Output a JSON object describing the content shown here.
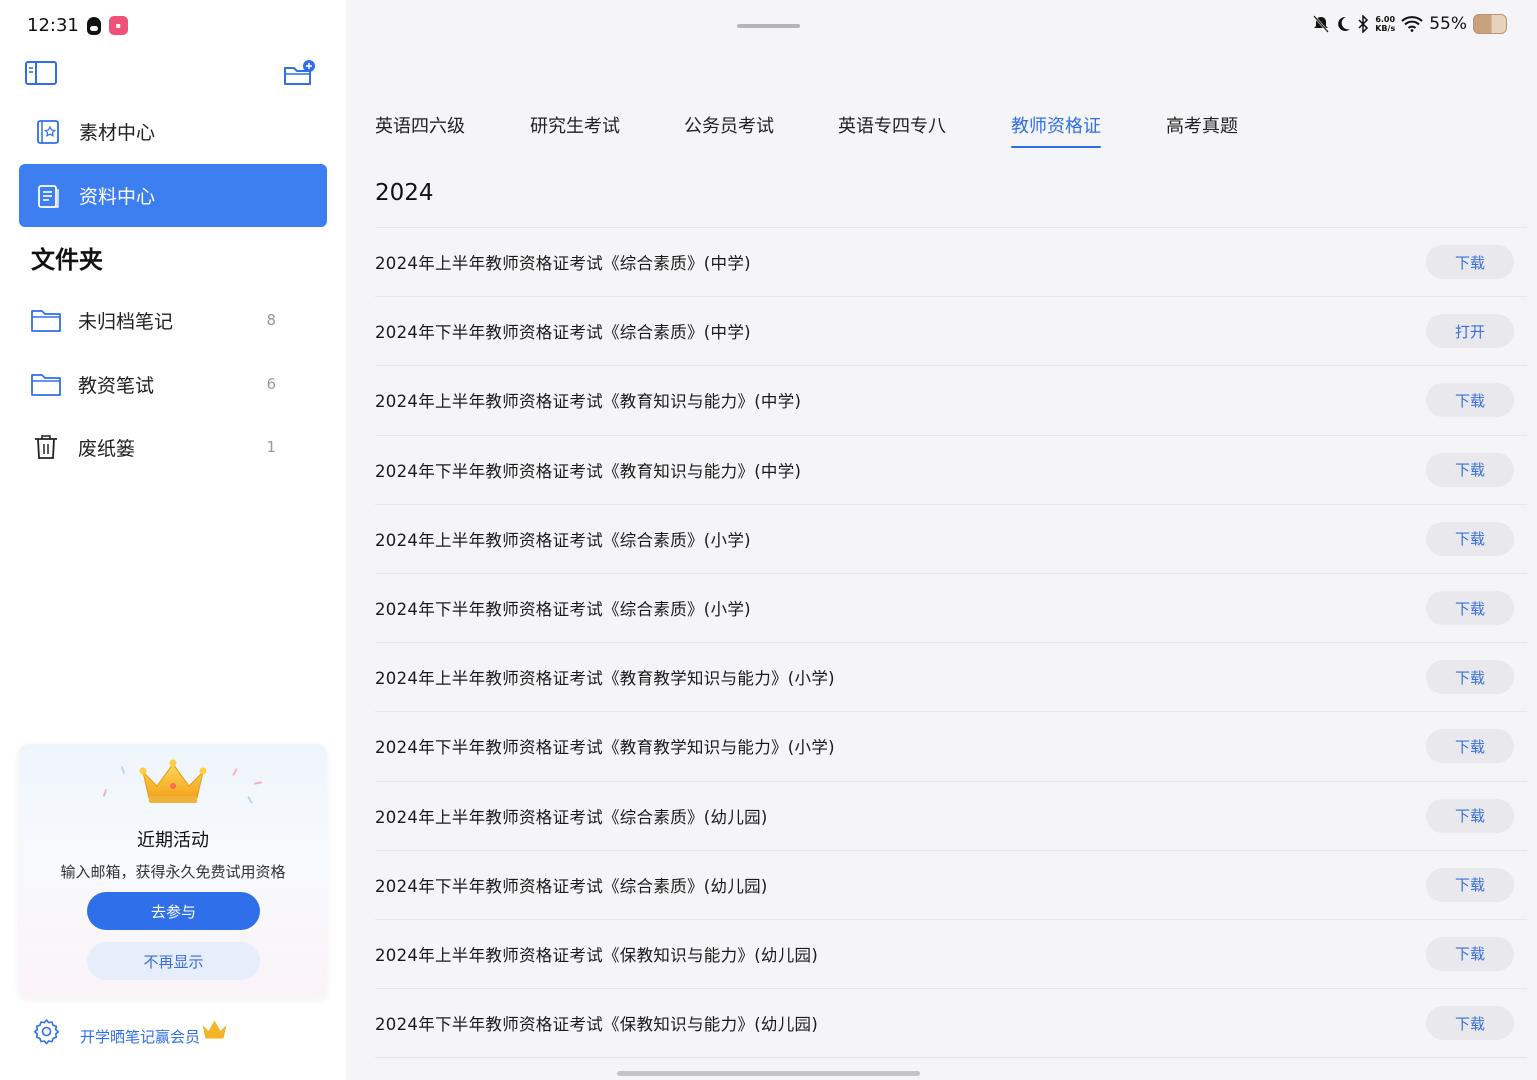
{
  "status": {
    "time": "12:31",
    "net_speed_value": "6.00",
    "net_speed_unit": "KB/s",
    "battery": "55%"
  },
  "sidebar": {
    "nav": [
      {
        "label": "素材中心",
        "active": false
      },
      {
        "label": "资料中心",
        "active": true
      }
    ],
    "folders_title": "文件夹",
    "folders": [
      {
        "label": "未归档笔记",
        "count": "8"
      },
      {
        "label": "教资笔试",
        "count": "6"
      },
      {
        "label": "废纸篓",
        "count": "1"
      }
    ],
    "promo": {
      "title": "近期活动",
      "desc": "输入邮箱，获得永久免费试用资格",
      "join": "去参与",
      "dismiss": "不再显示"
    },
    "footer_label": "开学晒笔记赢会员"
  },
  "tabs": [
    {
      "label": "英语四六级",
      "active": false
    },
    {
      "label": "研究生考试",
      "active": false
    },
    {
      "label": "公务员考试",
      "active": false
    },
    {
      "label": "英语专四专八",
      "active": false
    },
    {
      "label": "教师资格证",
      "active": true
    },
    {
      "label": "高考真题",
      "active": false
    }
  ],
  "year": "2024",
  "items": [
    {
      "title": "2024年上半年教师资格证考试《综合素质》(中学)",
      "action": "下载"
    },
    {
      "title": "2024年下半年教师资格证考试《综合素质》(中学)",
      "action": "打开"
    },
    {
      "title": "2024年上半年教师资格证考试《教育知识与能力》(中学)",
      "action": "下载"
    },
    {
      "title": "2024年下半年教师资格证考试《教育知识与能力》(中学)",
      "action": "下载"
    },
    {
      "title": "2024年上半年教师资格证考试《综合素质》(小学)",
      "action": "下载"
    },
    {
      "title": "2024年下半年教师资格证考试《综合素质》(小学)",
      "action": "下载"
    },
    {
      "title": "2024年上半年教师资格证考试《教育教学知识与能力》(小学)",
      "action": "下载"
    },
    {
      "title": "2024年下半年教师资格证考试《教育教学知识与能力》(小学)",
      "action": "下载"
    },
    {
      "title": "2024年上半年教师资格证考试《综合素质》(幼儿园)",
      "action": "下载"
    },
    {
      "title": "2024年下半年教师资格证考试《综合素质》(幼儿园)",
      "action": "下载"
    },
    {
      "title": "2024年上半年教师资格证考试《保教知识与能力》(幼儿园)",
      "action": "下载"
    },
    {
      "title": "2024年下半年教师资格证考试《保教知识与能力》(幼儿园)",
      "action": "下载"
    }
  ],
  "colors": {
    "accent": "#2f6fe9",
    "active_nav": "#3d7ff0",
    "button_bg": "#e9e9ed"
  }
}
